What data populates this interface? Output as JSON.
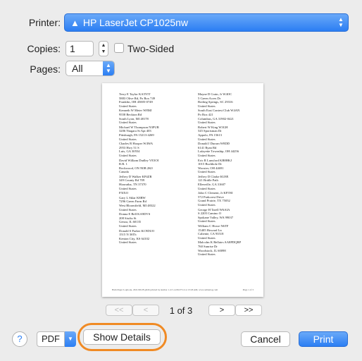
{
  "form": {
    "printer_label": "Printer:",
    "printer_value": "HP LaserJet CP1025nw",
    "copies_label": "Copies:",
    "copies_value": "1",
    "two_sided_label": "Two-Sided",
    "pages_label": "Pages:",
    "pages_value": "All"
  },
  "preview": {
    "left_column": [
      "Terry E Taylor KA5YIT\n5883 Olive Rd, Po Box 749\nFranklin, OH 45005-0749\nUnited States",
      "Kenneth W Meier W8MJ\n9558 Beckton Rd\nSouth Lyon, MI 48178\nUnited States",
      "Michael W Thompson N3PUR\n3206 Niagara St Apt 403\nPittsburgh, PA 15213-4269\nUnited States",
      "Charles R Hooper W4WA\n2953 Hwy 51 S\nLuis, GA 30554\nUnited States",
      "David William Dudley VE3OI\nR.R. 1\nRockwood, ON N0B 2K0\nCanada",
      "Jeffrey D Walker KP4ZR\n349 County Rd 709\nHiawatha, TN 37370\nUnited States",
      "F5IXO",
      "Gary L Sklar K8RW\n7296 Green Farm Rd\nWest Bloomfield, MI 48322\nUnited States",
      "Donna E Bell KA9DVS\n208 Sixiks St\nGenoa, IL 60135\nUnited States",
      "Donald S Parker KC9DUO\n1515 N 36Th\nKenton City, KS 64102\nUnited States"
    ],
    "right_column": [
      "Mayne D Crain, Jr W4OC\n5 Green Acres Dr\nBoiling Springs, SC 29316\nUnited States",
      "South East Contest Club W4AN\nPo Box 421\nColumbus, GA 31902-0421\nUnited States",
      "Robert W King W3GH\n545 Sportsman Dr\nAppolo, PA 15613\nUnited States",
      "Donald J Durran W8DD\n6141 Ryan Rd\nLafayette Township, OH 44256\nUnited States",
      "Eric R Lunsford KB8HKJ\n1015 Buchholz Dr\nWooster, OH 44691\nUnited States",
      "Jeffrey D Clarke KU8E\n121 Bridle Path\nEllenville, GA 31607\nUnited States",
      "John C Clement, Jr KF5NI\n572 Parkcrest Drive\nGrand Prairie, TX 75052\nUnited States",
      "George H Tarell W6AIA\nS 2205 Camino O\nSpokane Valley, WA 99037\nUnited States",
      "William C Howe N6TF\n15405 Howard Ln\nCaliente, CA 93518\nUnited States",
      "Malcolm K Bellairs AA8PDQRP\n760 Sunrise Dr\nWoodstock, IL 60098\nUnited States"
    ],
    "footer": "Ham Paper Logbook, 2021/06/28 @ldb printed by Author 1.4.5 on 06/27/14 at 13:26 AM, www.aaltnelog.com",
    "page_number": "Page 1 of 3"
  },
  "nav": {
    "first": "<<",
    "prev": "<",
    "page_indicator": "1 of 3",
    "next": ">",
    "last": ">>"
  },
  "bottom": {
    "help": "?",
    "pdf": "PDF",
    "show_details": "Show Details",
    "cancel": "Cancel",
    "print": "Print"
  }
}
